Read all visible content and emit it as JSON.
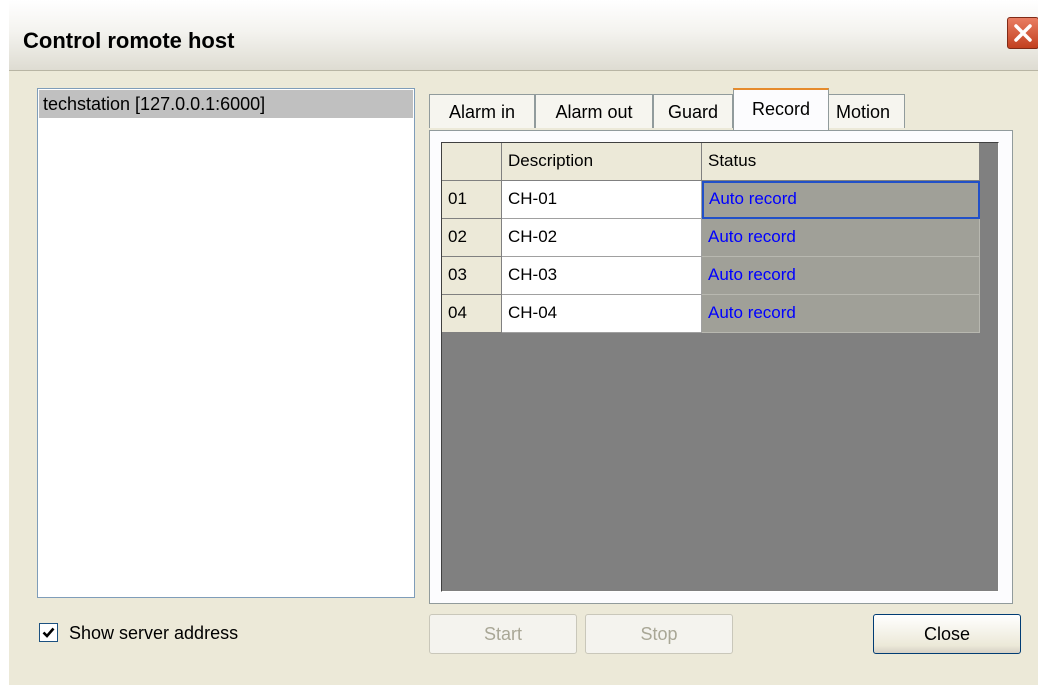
{
  "window": {
    "title": "Control romote host"
  },
  "host_list": {
    "items": [
      "techstation [127.0.0.1:6000]"
    ]
  },
  "show_server_address": {
    "label": "Show server address",
    "checked": true
  },
  "tabs": [
    {
      "label": "Alarm in",
      "active": false
    },
    {
      "label": "Alarm out",
      "active": false
    },
    {
      "label": "Guard",
      "active": false
    },
    {
      "label": "Record",
      "active": true
    },
    {
      "label": "Motion",
      "active": false
    }
  ],
  "grid": {
    "columns": [
      "Description",
      "Status"
    ],
    "rows": [
      {
        "id": "01",
        "description": "CH-01",
        "status": "Auto record"
      },
      {
        "id": "02",
        "description": "CH-02",
        "status": "Auto record"
      },
      {
        "id": "03",
        "description": "CH-03",
        "status": "Auto record"
      },
      {
        "id": "04",
        "description": "CH-04",
        "status": "Auto record"
      }
    ]
  },
  "buttons": {
    "start": "Start",
    "stop": "Stop",
    "close": "Close"
  },
  "colors": {
    "status_text": "#0000ff",
    "selection": "#c0c0c0",
    "tab_highlight": "#e68b2c"
  },
  "icons": {
    "title_close": "close-icon",
    "checkbox": "checkmark-icon"
  }
}
